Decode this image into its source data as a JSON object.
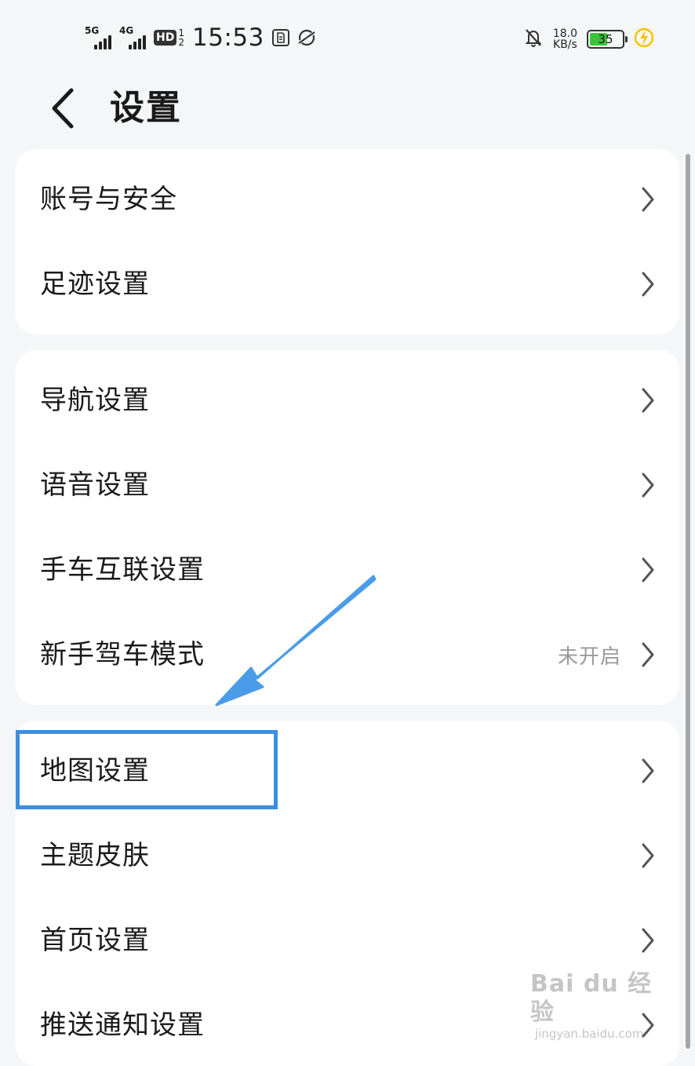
{
  "status_bar": {
    "network_1": "5G",
    "network_2": "4G",
    "hd_label": "HD",
    "hd_sub_1": "1",
    "hd_sub_2": "2",
    "time": "15:53",
    "net_speed_value": "18.0",
    "net_speed_unit": "KB/s",
    "battery_level": "35",
    "battery_color": "#3ac43a",
    "charging_color": "#f5c400"
  },
  "header": {
    "back_icon": "chevron-left-icon",
    "title": "设置"
  },
  "groups": [
    {
      "items": [
        {
          "label": "账号与安全",
          "value": ""
        },
        {
          "label": "足迹设置",
          "value": ""
        }
      ]
    },
    {
      "items": [
        {
          "label": "导航设置",
          "value": ""
        },
        {
          "label": "语音设置",
          "value": ""
        },
        {
          "label": "手车互联设置",
          "value": ""
        },
        {
          "label": "新手驾车模式",
          "value": "未开启"
        }
      ]
    },
    {
      "items": [
        {
          "label": "地图设置",
          "value": ""
        },
        {
          "label": "主题皮肤",
          "value": ""
        },
        {
          "label": "首页设置",
          "value": ""
        },
        {
          "label": "推送通知设置",
          "value": ""
        }
      ]
    }
  ],
  "annotation": {
    "highlight_color": "#3b8fe0",
    "arrow_color": "#4a9ce8"
  },
  "watermark": {
    "main": "Bai du 经验",
    "sub": "jingyan.baidu.com"
  }
}
